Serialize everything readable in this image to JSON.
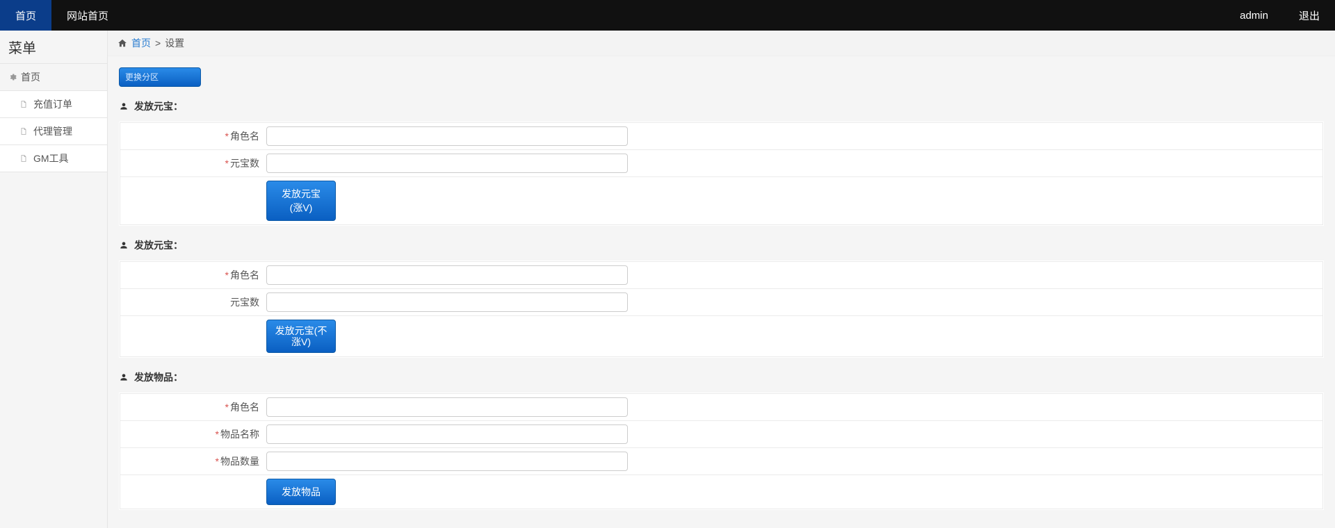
{
  "topbar": {
    "tab_home": "首页",
    "tab_site": "网站首页",
    "right_user": "admin",
    "right_logout": "退出"
  },
  "sidebar": {
    "title": "菜单",
    "home_label": "首页",
    "items": [
      {
        "label": "充值订单"
      },
      {
        "label": "代理管理"
      },
      {
        "label": "GM工具"
      }
    ]
  },
  "breadcrumb": {
    "home": "首页",
    "current": "设置",
    "sep": ">"
  },
  "page": {
    "partition_btn": "更换分区",
    "sections": [
      {
        "title": "发放元宝：",
        "rows": [
          {
            "required": true,
            "label": "角色名",
            "value": ""
          },
          {
            "required": true,
            "label": "元宝数",
            "value": ""
          }
        ],
        "submit": "发放元宝(涨V)"
      },
      {
        "title": "发放元宝：",
        "rows": [
          {
            "required": true,
            "label": "角色名",
            "value": ""
          },
          {
            "required": false,
            "label": "元宝数",
            "value": ""
          }
        ],
        "submit": "发放元宝(不涨V)"
      },
      {
        "title": "发放物品：",
        "rows": [
          {
            "required": true,
            "label": "角色名",
            "value": ""
          },
          {
            "required": true,
            "label": "物品名称",
            "value": ""
          },
          {
            "required": true,
            "label": "物品数量",
            "value": ""
          }
        ],
        "submit": "发放物品"
      }
    ]
  },
  "star": "*"
}
